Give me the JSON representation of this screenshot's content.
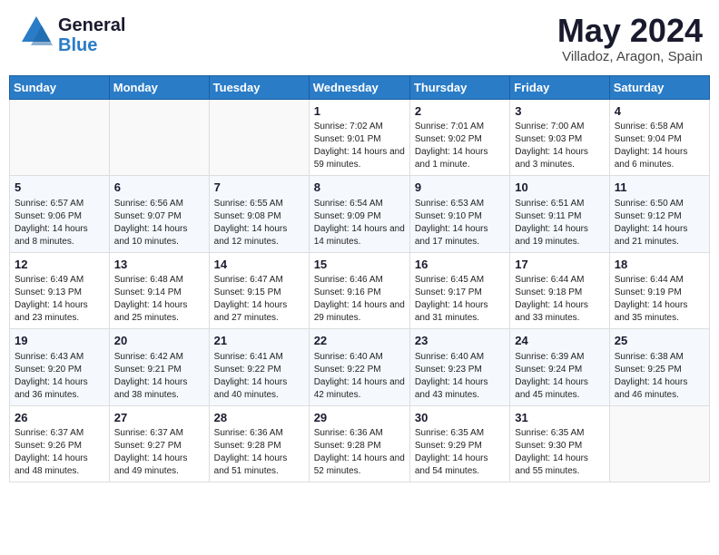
{
  "app": {
    "name_general": "General",
    "name_blue": "Blue",
    "title": "May 2024",
    "location": "Villadoz, Aragon, Spain"
  },
  "calendar": {
    "days_of_week": [
      "Sunday",
      "Monday",
      "Tuesday",
      "Wednesday",
      "Thursday",
      "Friday",
      "Saturday"
    ],
    "weeks": [
      [
        {
          "day": "",
          "info": ""
        },
        {
          "day": "",
          "info": ""
        },
        {
          "day": "",
          "info": ""
        },
        {
          "day": "1",
          "info": "Sunrise: 7:02 AM\nSunset: 9:01 PM\nDaylight: 14 hours and 59 minutes."
        },
        {
          "day": "2",
          "info": "Sunrise: 7:01 AM\nSunset: 9:02 PM\nDaylight: 14 hours and 1 minute."
        },
        {
          "day": "3",
          "info": "Sunrise: 7:00 AM\nSunset: 9:03 PM\nDaylight: 14 hours and 3 minutes."
        },
        {
          "day": "4",
          "info": "Sunrise: 6:58 AM\nSunset: 9:04 PM\nDaylight: 14 hours and 6 minutes."
        }
      ],
      [
        {
          "day": "5",
          "info": "Sunrise: 6:57 AM\nSunset: 9:06 PM\nDaylight: 14 hours and 8 minutes."
        },
        {
          "day": "6",
          "info": "Sunrise: 6:56 AM\nSunset: 9:07 PM\nDaylight: 14 hours and 10 minutes."
        },
        {
          "day": "7",
          "info": "Sunrise: 6:55 AM\nSunset: 9:08 PM\nDaylight: 14 hours and 12 minutes."
        },
        {
          "day": "8",
          "info": "Sunrise: 6:54 AM\nSunset: 9:09 PM\nDaylight: 14 hours and 14 minutes."
        },
        {
          "day": "9",
          "info": "Sunrise: 6:53 AM\nSunset: 9:10 PM\nDaylight: 14 hours and 17 minutes."
        },
        {
          "day": "10",
          "info": "Sunrise: 6:51 AM\nSunset: 9:11 PM\nDaylight: 14 hours and 19 minutes."
        },
        {
          "day": "11",
          "info": "Sunrise: 6:50 AM\nSunset: 9:12 PM\nDaylight: 14 hours and 21 minutes."
        }
      ],
      [
        {
          "day": "12",
          "info": "Sunrise: 6:49 AM\nSunset: 9:13 PM\nDaylight: 14 hours and 23 minutes."
        },
        {
          "day": "13",
          "info": "Sunrise: 6:48 AM\nSunset: 9:14 PM\nDaylight: 14 hours and 25 minutes."
        },
        {
          "day": "14",
          "info": "Sunrise: 6:47 AM\nSunset: 9:15 PM\nDaylight: 14 hours and 27 minutes."
        },
        {
          "day": "15",
          "info": "Sunrise: 6:46 AM\nSunset: 9:16 PM\nDaylight: 14 hours and 29 minutes."
        },
        {
          "day": "16",
          "info": "Sunrise: 6:45 AM\nSunset: 9:17 PM\nDaylight: 14 hours and 31 minutes."
        },
        {
          "day": "17",
          "info": "Sunrise: 6:44 AM\nSunset: 9:18 PM\nDaylight: 14 hours and 33 minutes."
        },
        {
          "day": "18",
          "info": "Sunrise: 6:44 AM\nSunset: 9:19 PM\nDaylight: 14 hours and 35 minutes."
        }
      ],
      [
        {
          "day": "19",
          "info": "Sunrise: 6:43 AM\nSunset: 9:20 PM\nDaylight: 14 hours and 36 minutes."
        },
        {
          "day": "20",
          "info": "Sunrise: 6:42 AM\nSunset: 9:21 PM\nDaylight: 14 hours and 38 minutes."
        },
        {
          "day": "21",
          "info": "Sunrise: 6:41 AM\nSunset: 9:22 PM\nDaylight: 14 hours and 40 minutes."
        },
        {
          "day": "22",
          "info": "Sunrise: 6:40 AM\nSunset: 9:22 PM\nDaylight: 14 hours and 42 minutes."
        },
        {
          "day": "23",
          "info": "Sunrise: 6:40 AM\nSunset: 9:23 PM\nDaylight: 14 hours and 43 minutes."
        },
        {
          "day": "24",
          "info": "Sunrise: 6:39 AM\nSunset: 9:24 PM\nDaylight: 14 hours and 45 minutes."
        },
        {
          "day": "25",
          "info": "Sunrise: 6:38 AM\nSunset: 9:25 PM\nDaylight: 14 hours and 46 minutes."
        }
      ],
      [
        {
          "day": "26",
          "info": "Sunrise: 6:37 AM\nSunset: 9:26 PM\nDaylight: 14 hours and 48 minutes."
        },
        {
          "day": "27",
          "info": "Sunrise: 6:37 AM\nSunset: 9:27 PM\nDaylight: 14 hours and 49 minutes."
        },
        {
          "day": "28",
          "info": "Sunrise: 6:36 AM\nSunset: 9:28 PM\nDaylight: 14 hours and 51 minutes."
        },
        {
          "day": "29",
          "info": "Sunrise: 6:36 AM\nSunset: 9:28 PM\nDaylight: 14 hours and 52 minutes."
        },
        {
          "day": "30",
          "info": "Sunrise: 6:35 AM\nSunset: 9:29 PM\nDaylight: 14 hours and 54 minutes."
        },
        {
          "day": "31",
          "info": "Sunrise: 6:35 AM\nSunset: 9:30 PM\nDaylight: 14 hours and 55 minutes."
        },
        {
          "day": "",
          "info": ""
        }
      ]
    ]
  }
}
